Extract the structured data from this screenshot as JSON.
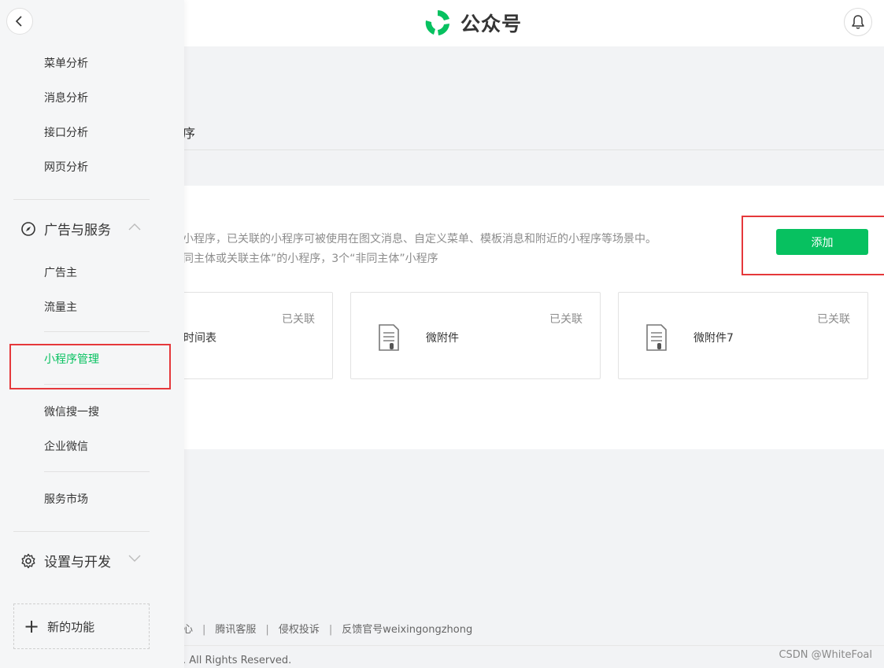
{
  "header": {
    "logo_text": "公众号",
    "brand_color": "#07c160"
  },
  "main": {
    "tab_fragment": "序",
    "description_line1": "小程序，已关联的小程序可被使用在图文消息、自定义菜单、模板消息和附近的小程序等场景中。",
    "description_line2": "同主体或关联主体”的小程序，3个“非同主体”小程序",
    "add_button_label": "添加",
    "apps": [
      {
        "name": "时间表",
        "status": "已关联"
      },
      {
        "name": "微附件",
        "status": "已关联"
      },
      {
        "name": "微附件7",
        "status": "已关联"
      }
    ]
  },
  "footer": {
    "links": [
      "心",
      "腾讯客服",
      "侵权投诉",
      "反馈官号weixingongzhong"
    ],
    "copyright": ". All Rights Reserved.",
    "watermark": "CSDN @WhiteFoal"
  },
  "sidebar": {
    "analysis_items": [
      "菜单分析",
      "消息分析",
      "接口分析",
      "网页分析"
    ],
    "ads_section": "广告与服务",
    "ads_items": [
      "广告主",
      "流量主"
    ],
    "miniprogram_item": "小程序管理",
    "search_items": [
      "微信搜一搜",
      "企业微信"
    ],
    "market_item": "服务市场",
    "settings_section": "设置与开发",
    "new_feature": "新的功能"
  }
}
